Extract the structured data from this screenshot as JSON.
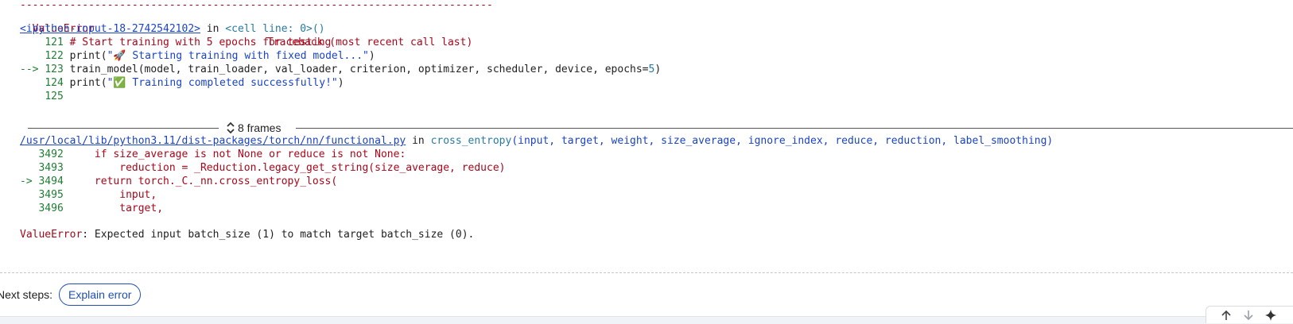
{
  "traceback": {
    "dashes": "----------------------------------------------------------------------------",
    "error_type": "ValueError",
    "header_right": "Traceback (most recent call last)",
    "frame1": {
      "file_link": "<ipython-input-18-2742542102>",
      "in_word": " in ",
      "cell_line": "<cell line: 0>()",
      "lines": [
        {
          "arrow": "    ",
          "num": "121",
          "code": "# Start training with 5 epochs for testing"
        },
        {
          "arrow": "    ",
          "num": "122",
          "code_pre": "print(",
          "str_quote": "\"",
          "emoji": "🚀",
          "str": " Starting training with fixed model...\"",
          "code_post": ")"
        },
        {
          "arrow": "--> ",
          "num": "123",
          "code": "train_model(model, train_loader, val_loader, criterion, optimizer, scheduler, device, epochs=",
          "num_arg": "5",
          "code_post": ")"
        },
        {
          "arrow": "    ",
          "num": "124",
          "code_pre": "print(",
          "str_quote": "\"",
          "emoji": "✅",
          "str": " Training completed successfully!\"",
          "code_post": ")"
        },
        {
          "arrow": "    ",
          "num": "125",
          "code": ""
        }
      ]
    },
    "frames_toggle": "8 frames",
    "frame2": {
      "file_link": "/usr/local/lib/python3.11/dist-packages/torch/nn/functional.py",
      "in_word": " in ",
      "func": "cross_entropy",
      "args": "(input, target, weight, size_average, ignore_index, reduce, reduction, label_smoothing)",
      "lines": [
        {
          "arrow": "   ",
          "num": "3492",
          "code": "    if size_average is not None or reduce is not None:"
        },
        {
          "arrow": "   ",
          "num": "3493",
          "code": "        reduction = _Reduction.legacy_get_string(size_average, reduce)"
        },
        {
          "arrow": "-> ",
          "num": "3494",
          "code": "    return torch._C._nn.cross_entropy_loss("
        },
        {
          "arrow": "   ",
          "num": "3495",
          "code": "        input,"
        },
        {
          "arrow": "   ",
          "num": "3496",
          "code": "        target,"
        }
      ]
    },
    "final_error_type": "ValueError",
    "final_error_msg": ": Expected input batch_size (1) to match target batch_size (0)."
  },
  "next_steps": {
    "label": "Next steps:",
    "explain_button": "Explain error"
  },
  "toolbar": {
    "icons": [
      "arrow-up-icon",
      "arrow-down-icon",
      "sparkle-icon"
    ]
  }
}
